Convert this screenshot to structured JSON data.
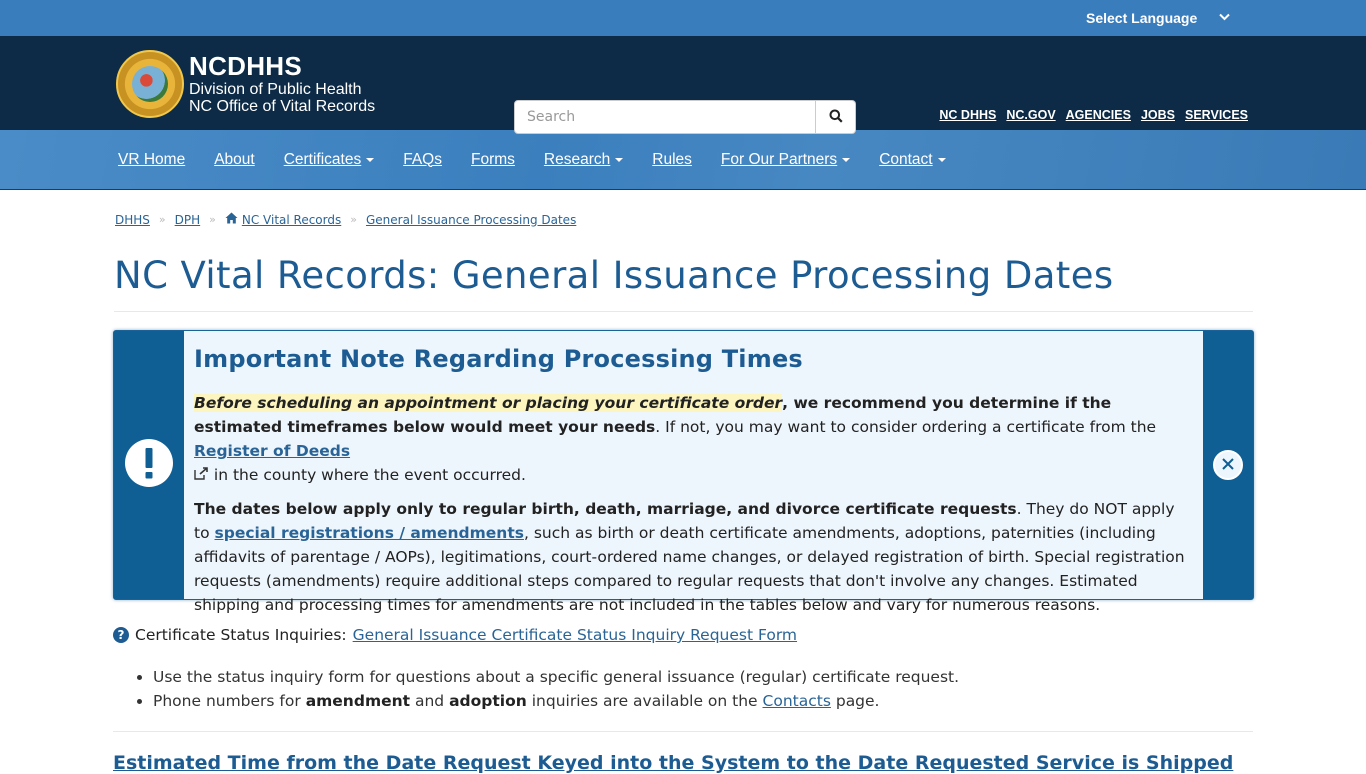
{
  "language": {
    "label": "Select Language",
    "icon": "chevron-down-icon"
  },
  "header": {
    "logo": {
      "title": "NCDHHS",
      "line1": "Division of Public Health",
      "line2": "NC Office of Vital Records"
    },
    "search": {
      "placeholder": "Search",
      "value": "",
      "icon": "search-icon"
    },
    "utility_links": [
      "NC DHHS",
      "NC.GOV",
      "AGENCIES",
      "JOBS",
      "SERVICES"
    ]
  },
  "nav": {
    "items": [
      {
        "label": "VR Home",
        "dropdown": false
      },
      {
        "label": "About",
        "dropdown": false
      },
      {
        "label": "Certificates",
        "dropdown": true
      },
      {
        "label": "FAQs",
        "dropdown": false
      },
      {
        "label": "Forms",
        "dropdown": false
      },
      {
        "label": "Research",
        "dropdown": true
      },
      {
        "label": "Rules",
        "dropdown": false
      },
      {
        "label": "For Our Partners",
        "dropdown": true
      },
      {
        "label": "Contact",
        "dropdown": true
      }
    ]
  },
  "breadcrumb": {
    "items": [
      "DHHS",
      "DPH",
      "NC Vital Records",
      "General Issuance Processing Dates"
    ],
    "separator": "»"
  },
  "page": {
    "title": "NC Vital Records: General Issuance Processing Dates"
  },
  "alert": {
    "icon": "exclamation-icon",
    "heading": "Important Note Regarding Processing Times",
    "p1": {
      "highlight": "Before scheduling an appointment or placing your certificate order",
      "bold": ", we recommend you determine if the estimated timeframes below would meet your needs",
      "text1": ". If not, you may want to consider ordering a certificate from the ",
      "link": "Register of Deeds",
      "text2": " in the county where the event occurred."
    },
    "p2": {
      "bold": "The dates below apply only to regular birth, death, marriage, and divorce certificate requests",
      "text1": ". They do NOT apply to ",
      "link": "special registrations / amendments",
      "text2": ", such as birth or death certificate amendments, adoptions, paternities (including affidavits of parentage / AOPs), legitimations, court-ordered name changes, or delayed registration of birth. Special registration requests (amendments) require additional steps compared to regular requests that don't involve any changes. Estimated shipping and processing times for amendments are not included in the tables below and vary for numerous reasons."
    },
    "close_icon": "close-icon"
  },
  "status": {
    "label": "Certificate Status Inquiries:",
    "link": "General Issuance Certificate Status Inquiry Request Form",
    "bullets": {
      "b1": "Use the status inquiry form for questions about a specific general issuance (regular) certificate request.",
      "b2_pre": "Phone numbers for ",
      "b2_bold1": "amendment",
      "b2_mid": " and ",
      "b2_bold2": "adoption",
      "b2_text": " inquiries are available on the ",
      "b2_link": "Contacts",
      "b2_post": " page."
    }
  },
  "section": {
    "heading": "Estimated Time from the Date Request Keyed into the System to the Date Requested Service is Shipped"
  }
}
